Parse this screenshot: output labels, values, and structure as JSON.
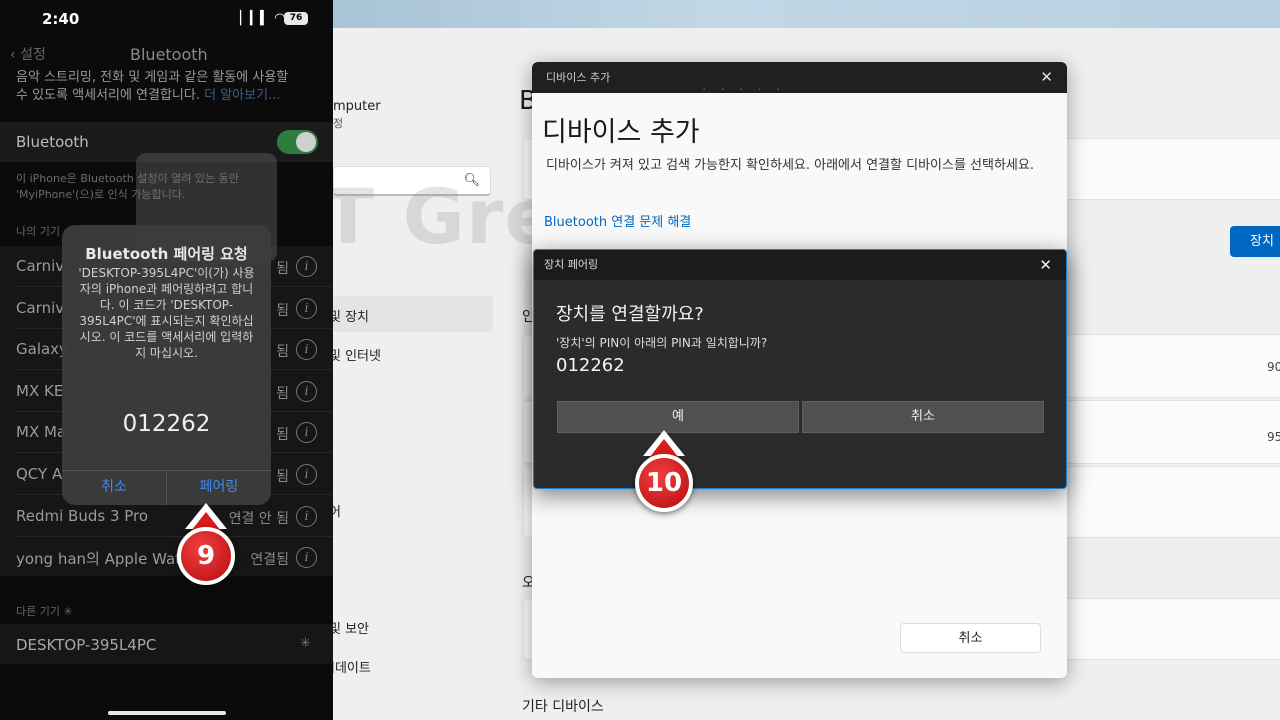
{
  "phone": {
    "status_time": "2:40",
    "battery": "76",
    "back_label": "설정",
    "nav_title": "Bluetooth",
    "desc_line1": "음악 스트리밍, 전화 및 게임과 같은 활동에 사용할",
    "desc_line2": "수 있도록 액세서리에 연결합니다.",
    "desc_more": "더 알아보기...",
    "bluetooth_label": "Bluetooth",
    "toggle_on": true,
    "footnote_line1": "이 iPhone은 Bluetooth 설정이 열려 있는 동안",
    "footnote_line2": "'MyiPhone'(으)로 인식 가능합니다.",
    "section_mine": "나의 기기",
    "devices": [
      {
        "name": "Carniv",
        "status": "됨"
      },
      {
        "name": "Carniv",
        "status": "됨"
      },
      {
        "name": "Galaxy",
        "status": "됨"
      },
      {
        "name": "MX KE",
        "status": "됨"
      },
      {
        "name": "MX Ma",
        "status": "됨"
      },
      {
        "name": "QCY A",
        "status": "됨"
      },
      {
        "name": "Redmi Buds 3 Pro",
        "status": "연결 안 됨"
      },
      {
        "name": "yong han의 Apple Watc",
        "status": "연결됨"
      }
    ],
    "section_other": "다른 기기",
    "other_device": "DESKTOP-395L4PC",
    "alert": {
      "title": "Bluetooth 페어링 요청",
      "message": "'DESKTOP-395L4PC'이(가) 사용자의 iPhone과 페어링하려고 합니다. 이 코드가 'DESKTOP-395L4PC'에 표시되는지 확인하십시오. 이 코드를 액세서리에 입력하지 마십시오.",
      "code": "012262",
      "cancel": "취소",
      "pair": "페어링"
    },
    "step_badge": "9"
  },
  "windows": {
    "partial_computer": "mputer",
    "partial_sub": "정",
    "partial_heading": "B",
    "nav_devices": "및 장치",
    "nav_internet": "및 인터넷",
    "nav_partial_a": "어",
    "nav_security": "및 보안",
    "nav_update": "업데이트",
    "partial_section": "인",
    "partial_section2": "오",
    "partial_num1": "90",
    "partial_num2": "95",
    "other_devices": "기타 디바이스",
    "blue_button": "장치",
    "watermark": "IT Great King",
    "add_dialog": {
      "titlebar": "디바이스 추가",
      "heading": "디바이스 추가",
      "description": "디바이스가 켜져 있고 검색 가능한지 확인하세요. 아래에서 연결할 디바이스를 선택하세요.",
      "link": "Bluetooth 연결 문제 해결",
      "cancel": "취소"
    },
    "pair_dialog": {
      "titlebar": "장치 페어링",
      "heading": "장치를 연결할까요?",
      "question": "'장치'의 PIN이 아래의 PIN과 일치합니까?",
      "pin": "012262",
      "yes": "예",
      "cancel": "취소"
    },
    "step_badge": "10"
  },
  "colors": {
    "accent_blue": "#0067c0",
    "ios_blue": "#3d8ff0",
    "toggle_green": "#2e7d3e",
    "badge_red": "#d91b1b"
  }
}
